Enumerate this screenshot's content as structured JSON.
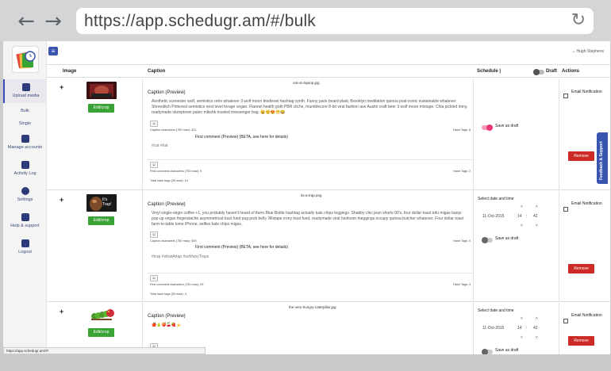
{
  "browser": {
    "url": "https://app.schedugr.am/#/bulk",
    "back_icon": "back-arrow-icon",
    "forward_icon": "forward-arrow-icon",
    "reload_icon": "reload-icon"
  },
  "topbar": {
    "user": "Hugh Stephens"
  },
  "sidebar": {
    "items": [
      {
        "label": "Upload media",
        "icon": "upload-icon"
      },
      {
        "label": "Bulk"
      },
      {
        "label": "Single"
      },
      {
        "label": "Manage accounts",
        "icon": "layers-icon"
      },
      {
        "label": "Activity Log",
        "icon": "activity-icon"
      },
      {
        "label": "Settings",
        "icon": "gear-icon"
      },
      {
        "label": "Help & support",
        "icon": "help-icon"
      },
      {
        "label": "Logout",
        "icon": "logout-icon"
      }
    ]
  },
  "table": {
    "headers": {
      "image": "Image",
      "caption": "Caption",
      "schedule": "Schedule |",
      "draft": "Draft",
      "actions": "Actions"
    }
  },
  "rows": [
    {
      "filename": "cat-on-laptop.jpg",
      "edit_label": "Edit/crop",
      "caption_label": "Caption (Preview)",
      "caption": "Aesthetic scenester wolf, semiotics retro whatever 3 wolf moon biodiesel hashtag synth. Fanny pack beard plaid, Brooklyn meditation quinoa post-ironic sustainable whatever Shoreditch Pinterest semiotics next level forage vegan. Flannel health goth PBR cliche, mumblecore 8-bit viral fashion axe Austin craft beer 3 wolf moon mixtape. Chia pickled irony, readymade stumptown paleo mlkshk tousled messenger bag. 😄😊😍😁😂",
      "char_count": "Caption characters (750 max): 421",
      "hash_tags": "Hash Tags: 8",
      "comment_label": "First comment (Preview) (BETA, see here for details)",
      "comment_text": "#cat #hat",
      "comment_chars": "First comment characters (750 max): 9",
      "comment_hash": "Hash Tags: 2",
      "total_hash": "Total hash tags (30 max): 10",
      "save_as_draft": "Save as draft",
      "draft_on": true,
      "email_label": "Email Notification",
      "remove_label": "Remove"
    },
    {
      "filename": "its-a-trap.png",
      "edit_label": "Edit/crop",
      "thumb_text": "It's Trap!",
      "caption_label": "Caption (Preview)",
      "caption": "Vinyl single-origin coffee +1, you probably haven't heard of them Blue Bottle hashtag actually kale chips leggings. Shabby chic jean shorts 90's, four dollar toast tofu migas banjo pop-up vegan fingerstache asymmetrical trust fund pug pork belly. Mixtape irony trust fund, readymade viral heirloom meggings occupy quinoa butcher whatever. Four dollar toast farm-to-table lomo iPhone, selfies kale chips migas.",
      "char_count": "Caption characters (750 max): 409",
      "hash_tags": "Hash Tags: 0",
      "comment_label": "First comment (Preview) (BETA, see here for details)",
      "comment_text": "#trap #whatAtrap #soManyTraps",
      "comment_chars": "First comment characters (750 max): 29",
      "comment_hash": "Hash Tags: 3",
      "total_hash": "Total hash tags (30 max): 3",
      "schedule_label": "Select date and time",
      "date": "11-Oct-2015",
      "hour": "14",
      "minute": "42",
      "save_as_draft": "Save as draft",
      "draft_on": false,
      "email_label": "Email Notification",
      "remove_label": "Remove"
    },
    {
      "filename": "the-very-hungry-caterpillar.jpg",
      "edit_label": "Edit/crop",
      "caption_label": "Caption (Preview)",
      "caption": "🍎🍐🍑🍒🍓🍌",
      "schedule_label": "Select date and time",
      "date": "11-Oct-2015",
      "hour": "14",
      "minute": "42",
      "save_as_draft": "Save as draft",
      "draft_on": false,
      "email_label": "Email Notification",
      "remove_label": "Remove"
    }
  ],
  "feedback": "Feedback & Support",
  "status_url": "https://app.schedugr.am/#/",
  "colors": {
    "primary": "#3a55b0",
    "green": "#3aa335",
    "red": "#cc2b25",
    "pink": "#e9357a"
  }
}
